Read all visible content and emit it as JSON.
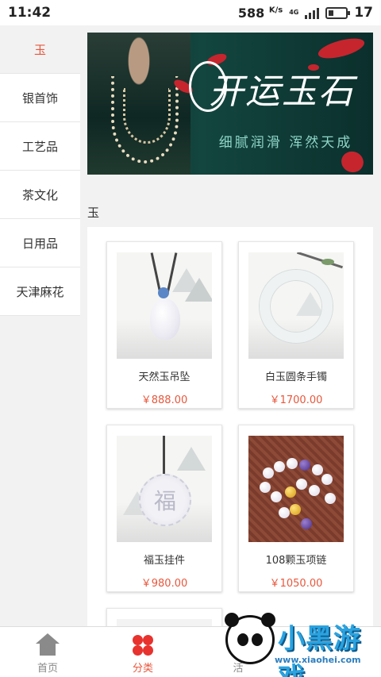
{
  "statusbar": {
    "time": "11:42",
    "speed": "588",
    "speed_unit": "K/s",
    "network": "4G",
    "battery": "17"
  },
  "sidebar": {
    "items": [
      {
        "label": "玉",
        "active": true
      },
      {
        "label": "银首饰",
        "active": false
      },
      {
        "label": "工艺品",
        "active": false
      },
      {
        "label": "茶文化",
        "active": false
      },
      {
        "label": "日用品",
        "active": false
      },
      {
        "label": "天津麻花",
        "active": false
      }
    ]
  },
  "banner": {
    "title": "开运玉石",
    "subtitle": "细腻润滑  浑然天成"
  },
  "section": {
    "title": "玉"
  },
  "products": [
    {
      "name": "天然玉吊坠",
      "price": "￥888.00",
      "image": "jade-pendant"
    },
    {
      "name": "白玉圆条手镯",
      "price": "￥1700.00",
      "image": "jade-bangle"
    },
    {
      "name": "福玉挂件",
      "price": "￥980.00",
      "image": "fu-jade-charm"
    },
    {
      "name": "108颗玉项链",
      "price": "￥1050.00",
      "image": "jade-bead-necklace"
    }
  ],
  "tabbar": {
    "tabs": [
      {
        "label": "首页",
        "icon": "home-icon",
        "active": false
      },
      {
        "label": "分类",
        "icon": "category-icon",
        "active": true
      },
      {
        "label": "活",
        "icon": "activity-icon",
        "active": false
      }
    ]
  },
  "watermark": {
    "text": "小黑游戏",
    "url": "www.xiaohei.com"
  },
  "colors": {
    "accent": "#e8573c",
    "banner_bg": "#13463f",
    "inactive_tab": "#888888"
  }
}
